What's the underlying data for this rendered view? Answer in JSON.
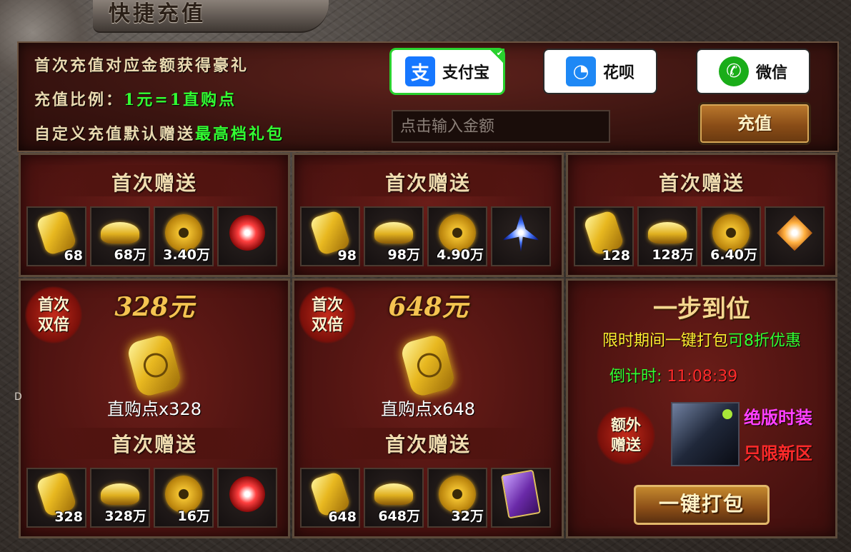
{
  "title": "快捷充值",
  "header": {
    "line1": "首次充值对应金额获得豪礼",
    "line2_label": "充值比例：",
    "line2_value": "1元=1直购点",
    "line3_label": "自定义充值默认赠送",
    "line3_value": "最高档礼包",
    "payments": [
      {
        "label": "支付宝",
        "icon": "alipay-icon",
        "color": "#1677ff",
        "glyph": "支",
        "selected": true
      },
      {
        "label": "花呗",
        "icon": "huabei-icon",
        "color": "#1e88f5",
        "glyph": "◔",
        "selected": false
      },
      {
        "label": "微信",
        "icon": "wechat-icon",
        "color": "#1aad19",
        "glyph": "✆",
        "selected": false
      }
    ],
    "amount_placeholder": "点击输入金额",
    "recharge_label": "充值"
  },
  "gift_label": "首次赠送",
  "tiers": [
    {
      "items": [
        {
          "icon": "gold-bar-icon",
          "num": "68"
        },
        {
          "icon": "gold-ingot-icon",
          "num": "68万"
        },
        {
          "icon": "gold-coin-icon",
          "num": "3.40万"
        },
        {
          "icon": "red-spirit-icon",
          "num": ""
        }
      ]
    },
    {
      "items": [
        {
          "icon": "gold-bar-icon",
          "num": "98"
        },
        {
          "icon": "gold-ingot-icon",
          "num": "98万"
        },
        {
          "icon": "gold-coin-icon",
          "num": "4.90万"
        },
        {
          "icon": "blue-crown-icon",
          "num": ""
        }
      ]
    },
    {
      "items": [
        {
          "icon": "gold-bar-icon",
          "num": "128"
        },
        {
          "icon": "gold-ingot-icon",
          "num": "128万"
        },
        {
          "icon": "gold-coin-icon",
          "num": "6.40万"
        },
        {
          "icon": "orange-emblem-icon",
          "num": ""
        }
      ]
    },
    {
      "badge": "首次双倍",
      "price": "328元",
      "points": "直购点x328",
      "items": [
        {
          "icon": "gold-bar-icon",
          "num": "328"
        },
        {
          "icon": "gold-ingot-icon",
          "num": "328万"
        },
        {
          "icon": "gold-coin-icon",
          "num": "16万"
        },
        {
          "icon": "red-swirl-icon",
          "num": ""
        }
      ]
    },
    {
      "badge": "首次双倍",
      "price": "648元",
      "points": "直购点x648",
      "items": [
        {
          "icon": "gold-bar-icon",
          "num": "648"
        },
        {
          "icon": "gold-ingot-icon",
          "num": "648万"
        },
        {
          "icon": "gold-coin-icon",
          "num": "32万"
        },
        {
          "icon": "purple-card-icon",
          "num": ""
        }
      ]
    }
  ],
  "promo": {
    "title": "一步到位",
    "line_prefix": "限时期间一键打包",
    "line_highlight": "可8折优惠",
    "countdown_label": "倒计时:",
    "countdown_value": "11:08:39",
    "extra_badge": "额外赠送",
    "costume_label1": "绝版时装",
    "costume_label2": "只限新区",
    "pack_button": "一键打包"
  },
  "side_marker": "D"
}
